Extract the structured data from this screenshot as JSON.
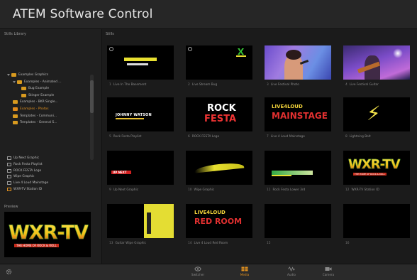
{
  "app": {
    "title": "ATEM Software Control"
  },
  "sidebar": {
    "header": "Stills Library",
    "tree": [
      {
        "label": "Examples Graphics",
        "level": 0,
        "type": "folder",
        "expanded": true
      },
      {
        "label": "Examples - Animated ...",
        "level": 1,
        "type": "folder",
        "expanded": true
      },
      {
        "label": "Bug Example",
        "level": 2,
        "type": "folder"
      },
      {
        "label": "Stinger Example",
        "level": 2,
        "type": "folder"
      },
      {
        "label": "Examples - BKR Single...",
        "level": 1,
        "type": "folder"
      },
      {
        "label": "Examples - Photos",
        "level": 1,
        "type": "folder",
        "selected": true
      },
      {
        "label": "Templates - Communi...",
        "level": 1,
        "type": "folder"
      },
      {
        "label": "Templates - General S...",
        "level": 1,
        "type": "folder"
      }
    ],
    "media": [
      {
        "label": "Up Next Graphic",
        "highlight": false
      },
      {
        "label": "Rock Festa Playlist",
        "highlight": false
      },
      {
        "label": "ROCK FESTA Logo",
        "highlight": false
      },
      {
        "label": "Wipe Graphic",
        "highlight": false
      },
      {
        "label": "Live 4 Loud Mainstage",
        "highlight": false
      },
      {
        "label": "WXR-TV Station ID",
        "highlight": true
      }
    ],
    "preview_label": "Preview",
    "preview_graphic": {
      "main": "WXR-TV",
      "sub": "THE HOME OF ROCK & ROLL"
    }
  },
  "main": {
    "header": "Stills",
    "tiles": [
      {
        "num": "1",
        "caption": "Live In The Basement",
        "kind": "text",
        "has_badge": true
      },
      {
        "num": "2",
        "caption": "Live Stream Bug",
        "kind": "bug",
        "has_badge": true
      },
      {
        "num": "3",
        "caption": "Live Festival Photo",
        "kind": "photo1"
      },
      {
        "num": "4",
        "caption": "Live Festival Guitar",
        "kind": "photo2"
      },
      {
        "num": "5",
        "caption": "Rock Festa Playlist",
        "kind": "lower",
        "text": "JOHNNY WATSON"
      },
      {
        "num": "6",
        "caption": "ROCK FESTA Logo",
        "kind": "rockfesta",
        "text_top": "ROCK",
        "text_bottom": "FESTA"
      },
      {
        "num": "7",
        "caption": "Live 4 Loud Mainstage",
        "kind": "mainstage",
        "text_top": "LIVE4LOUD",
        "text_bottom": "MAINSTAGE"
      },
      {
        "num": "8",
        "caption": "Lightning Bolt",
        "kind": "bolt",
        "symbol": "⚡"
      },
      {
        "num": "9",
        "caption": "Up Next Graphic",
        "kind": "upnext",
        "text": "UP NEXT"
      },
      {
        "num": "10",
        "caption": "Wipe Graphic",
        "kind": "wipe"
      },
      {
        "num": "11",
        "caption": "Rock Festa Lower 3rd",
        "kind": "lower3rd"
      },
      {
        "num": "12",
        "caption": "WXR-TV Station ID",
        "kind": "wxrtv",
        "text": "WXR-TV",
        "sub": "THE HOME OF ROCK & ROLL"
      },
      {
        "num": "13",
        "caption": "Guitar Wipe Graphic",
        "kind": "guitarwipe"
      },
      {
        "num": "14",
        "caption": "Live 4 Loud Red Room",
        "kind": "redroom",
        "text_top": "LIVE4LOUD",
        "text_bottom": "RED ROOM"
      },
      {
        "num": "15",
        "caption": "",
        "kind": "empty"
      },
      {
        "num": "16",
        "caption": "",
        "kind": "empty"
      }
    ]
  },
  "bottom_nav": [
    {
      "label": "Switcher",
      "icon": "switcher-icon",
      "active": false
    },
    {
      "label": "Media",
      "icon": "media-icon",
      "active": true
    },
    {
      "label": "Audio",
      "icon": "audio-icon",
      "active": false
    },
    {
      "label": "Camera",
      "icon": "camera-icon",
      "active": false
    }
  ],
  "colors": {
    "accent": "#e0901f",
    "folder": "#d89a1f",
    "yellow": "#f2e24a",
    "red": "#d32020",
    "green": "#33aa44"
  }
}
